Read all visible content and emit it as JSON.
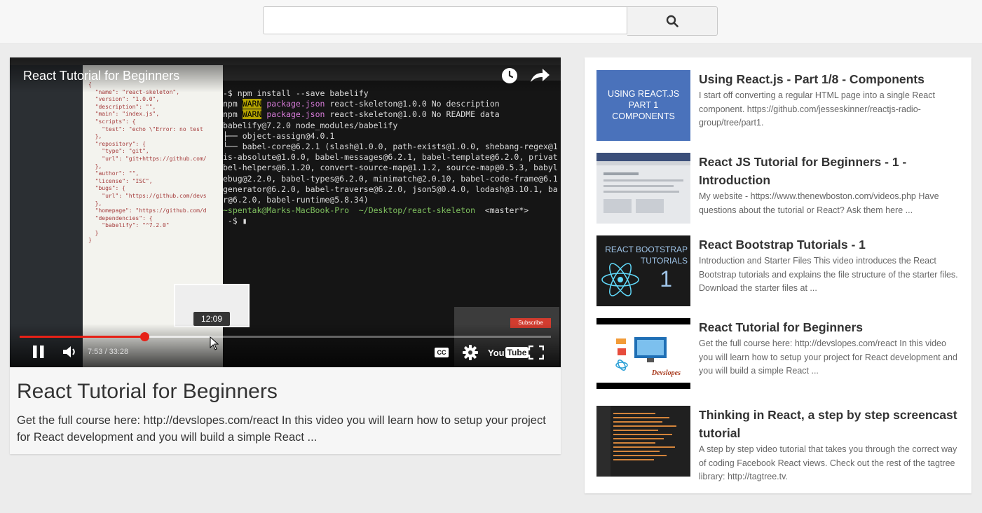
{
  "search": {
    "value": "",
    "placeholder": ""
  },
  "player": {
    "title": "React Tutorial for Beginners",
    "current_time": "7:53",
    "duration": "33:28",
    "time_display": "7:53 / 33:28",
    "preview_time": "12:09",
    "progress_played": 0.235,
    "progress_buffered": 0.36,
    "cc_label": "CC",
    "logo_you": "You",
    "logo_tube": "Tube",
    "subscribe_label": "Subscribe",
    "terminal_lines": [
      "npm WARN package.json react-skeleton@1.0.0 No description",
      "npm WARN package.json react-skeleton@1.0.0 No README data",
      "~spentak@Marks-MacBook-Pro ~/Desktop/react-skeleton <master*>"
    ]
  },
  "main": {
    "title": "React Tutorial for Beginners",
    "description": "Get the full course here: http://devslopes.com/react In this video you will learn how to setup your project for React development and you will build a simple React ..."
  },
  "related": [
    {
      "title": "Using React.js - Part 1/8 - Components",
      "description": "I start off converting a regular HTML page into a single React component. https://github.com/jesseskinner/reactjs-radio-group/tree/part1.",
      "thumb_text": "USING REACT.JS PART 1 COMPONENTS"
    },
    {
      "title": "React JS Tutorial for Beginners - 1 - Introduction",
      "description": "My website - https://www.thenewboston.com/videos.php Have questions about the tutorial or React? Ask them here ..."
    },
    {
      "title": "React Bootstrap Tutorials - 1",
      "description": "Introduction and Starter Files This video introduces the React Bootstrap tutorials and explains the file structure of the starter files. Download the starter files at ...",
      "thumb_text": "REACT BOOTSTRAP TUTORIALS",
      "thumb_number": "1"
    },
    {
      "title": "React Tutorial for Beginners",
      "description": "Get the full course here: http://devslopes.com/react In this video you will learn how to setup your project for React development and you will build a simple React ...",
      "thumb_text": "Devslopes"
    },
    {
      "title": "Thinking in React, a step by step screencast tutorial",
      "description": "A step by step video tutorial that takes you through the correct way of coding Facebook React views. Check out the rest of the tagtree library: http://tagtree.tv."
    }
  ],
  "colors": {
    "progress": "#e62117",
    "background": "#ececec",
    "card": "#ffffff"
  }
}
